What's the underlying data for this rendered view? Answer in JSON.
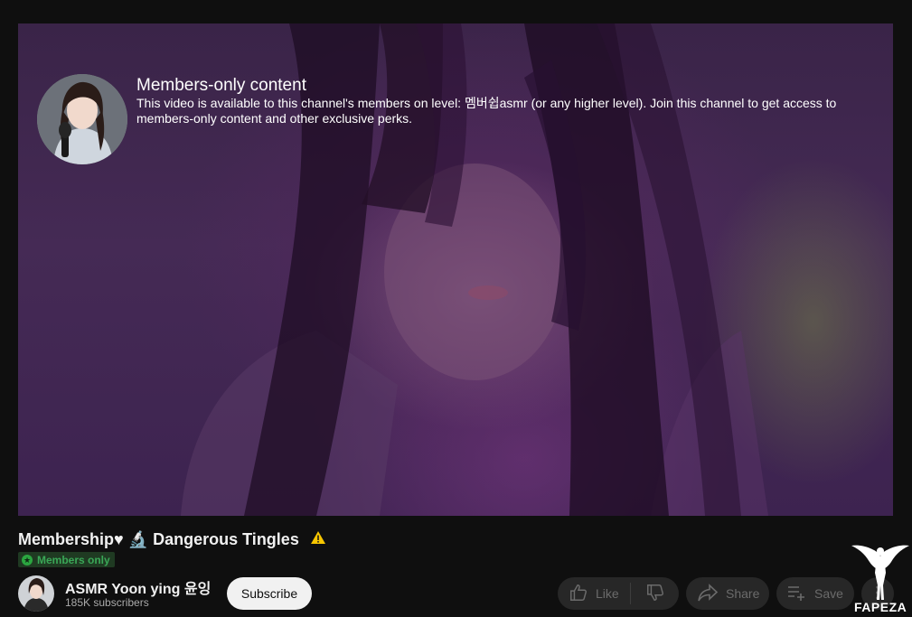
{
  "player": {
    "members_only_title": "Members-only content",
    "members_only_description": "This video is available to this channel's members on level: 멤버쉽asmr (or any higher level). Join this channel to get access to members-only content and other exclusive perks."
  },
  "video": {
    "title": "Membership♥ 🔬 Dangerous Tingles",
    "warning_icon": "warning-icon",
    "badge_label": "Members only"
  },
  "channel": {
    "name": "ASMR Yoon ying 윤잉",
    "subscribers": "185K subscribers",
    "subscribe_label": "Subscribe"
  },
  "actions": {
    "like_label": "Like",
    "share_label": "Share",
    "save_label": "Save"
  },
  "watermark": {
    "text": "FAPEZA"
  },
  "colors": {
    "background": "#0f0f0f",
    "badge_green": "#2ba640",
    "pill_bg": "#272727",
    "subscribe_bg": "#f1f1f1"
  }
}
